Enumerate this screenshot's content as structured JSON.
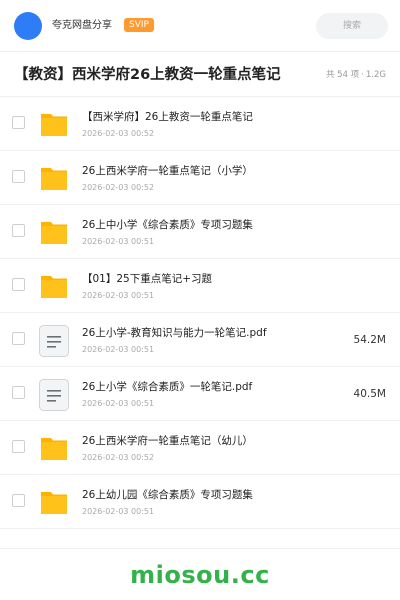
{
  "header": {
    "username": "夸克网盘分享",
    "badge": "SVIP",
    "search_placeholder": "搜索"
  },
  "folder": {
    "title": "【教资】西米学府26上教资一轮重点笔记",
    "count": "共 54 项",
    "separator": "·",
    "size": "1.2G"
  },
  "colors": {
    "accent": "#2f7df6",
    "badge": "#ff9a2e",
    "folder_icon": "#ffc21a",
    "watermark": "#33b24a"
  },
  "files": [
    {
      "icon": "folder-icon",
      "name": "【西米学府】26上教资一轮重点笔记",
      "date": "2026-02-03 00:52",
      "size": ""
    },
    {
      "icon": "folder-icon",
      "name": "26上西米学府一轮重点笔记（小学）",
      "date": "2026-02-03 00:52",
      "size": ""
    },
    {
      "icon": "folder-icon",
      "name": "26上中小学《综合素质》专项习题集",
      "date": "2026-02-03 00:51",
      "size": ""
    },
    {
      "icon": "folder-icon",
      "name": "【01】25下重点笔记+习题",
      "date": "2026-02-03 00:51",
      "size": ""
    },
    {
      "icon": "document-icon",
      "name": "26上小学-教育知识与能力一轮笔记.pdf",
      "date": "2026-02-03 00:51",
      "size": "54.2M"
    },
    {
      "icon": "document-icon",
      "name": "26上小学《综合素质》一轮笔记.pdf",
      "date": "2026-02-03 00:51",
      "size": "40.5M"
    },
    {
      "icon": "folder-icon",
      "name": "26上西米学府一轮重点笔记（幼儿）",
      "date": "2026-02-03 00:52",
      "size": ""
    },
    {
      "icon": "folder-icon",
      "name": "26上幼儿园《综合素质》专项习题集",
      "date": "2026-02-03 00:51",
      "size": ""
    }
  ],
  "footer": {
    "watermark": "miosou.cc"
  }
}
